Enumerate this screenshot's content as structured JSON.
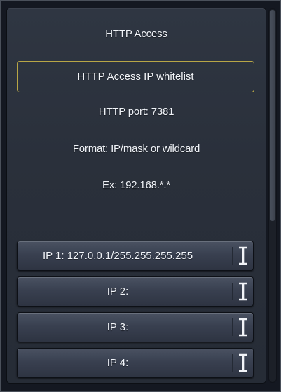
{
  "header": {
    "title": "HTTP Access"
  },
  "whitelist": {
    "label": "HTTP Access IP whitelist",
    "border_color": "#b8a646"
  },
  "info": {
    "port": "HTTP port: 7381",
    "format": "Format: IP/mask or wildcard",
    "example": "Ex: 192.168.*.*"
  },
  "ip_entries": [
    {
      "label": "IP 1: 127.0.0.1/255.255.255.255",
      "icon": "text-cursor-icon"
    },
    {
      "label": "IP 2:",
      "icon": "text-cursor-icon"
    },
    {
      "label": "IP 3:",
      "icon": "text-cursor-icon"
    },
    {
      "label": "IP 4:",
      "icon": "text-cursor-icon"
    }
  ]
}
